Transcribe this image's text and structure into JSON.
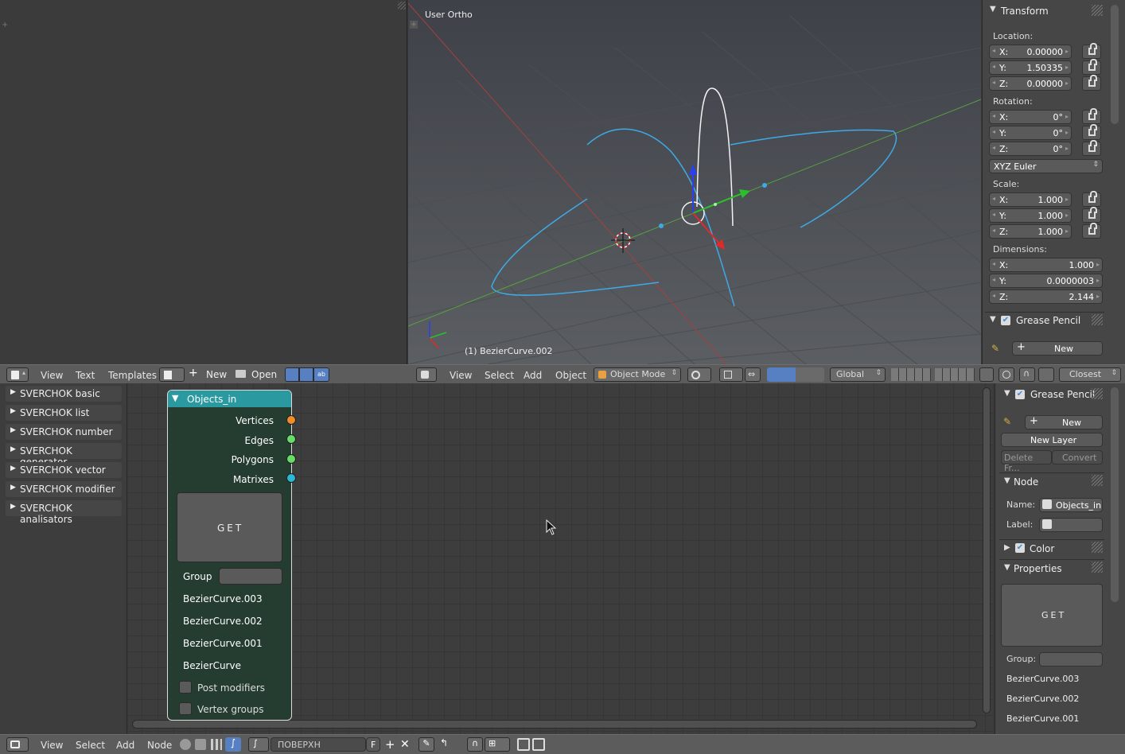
{
  "text_editor": {
    "menu": [
      "View",
      "Text",
      "Templates"
    ],
    "new_label": "New",
    "open_label": "Open"
  },
  "viewport": {
    "title": "User Ortho",
    "object_label": "(1) BezierCurve.002",
    "menu": [
      "View",
      "Select",
      "Add",
      "Object"
    ],
    "mode": "Object Mode",
    "orientation": "Global",
    "snap": "Closest"
  },
  "transform": {
    "title": "Transform",
    "location_label": "Location:",
    "location": [
      {
        "axis": "X:",
        "value": "0.00000"
      },
      {
        "axis": "Y:",
        "value": "1.50335"
      },
      {
        "axis": "Z:",
        "value": "0.00000"
      }
    ],
    "rotation_label": "Rotation:",
    "rotation": [
      {
        "axis": "X:",
        "value": "0°"
      },
      {
        "axis": "Y:",
        "value": "0°"
      },
      {
        "axis": "Z:",
        "value": "0°"
      }
    ],
    "rotation_mode": "XYZ Euler",
    "scale_label": "Scale:",
    "scale": [
      {
        "axis": "X:",
        "value": "1.000"
      },
      {
        "axis": "Y:",
        "value": "1.000"
      },
      {
        "axis": "Z:",
        "value": "1.000"
      }
    ],
    "dimensions_label": "Dimensions:",
    "dimensions": [
      {
        "axis": "X:",
        "value": "1.000"
      },
      {
        "axis": "Y:",
        "value": "0.0000003"
      },
      {
        "axis": "Z:",
        "value": "2.144"
      }
    ],
    "grease_pencil": "Grease Pencil",
    "gp_new": "New"
  },
  "sverchok": {
    "categories": [
      "SVERCHOK basic",
      "SVERCHOK list",
      "SVERCHOK number",
      "SVERCHOK generator",
      "SVERCHOK vector",
      "SVERCHOK modifier",
      "SVERCHOK analisators"
    ]
  },
  "node": {
    "title": "Objects_in",
    "outputs": [
      "Vertices",
      "Edges",
      "Polygons",
      "Matrixes"
    ],
    "get_button": "GET",
    "group_label": "Group",
    "objects": [
      "BezierCurve.003",
      "BezierCurve.002",
      "BezierCurve.001",
      "BezierCurve"
    ],
    "post_modifiers": "Post modifiers",
    "vertex_groups": "Vertex groups",
    "socket_colors": [
      "#f08c2a",
      "#66dd66",
      "#66dd66",
      "#2ab8d6"
    ]
  },
  "node_panel": {
    "grease_pencil": "Grease Pencil",
    "new_label": "New",
    "new_layer": "New Layer",
    "delete_frame": "Delete Fr...",
    "convert": "Convert",
    "node_section": "Node",
    "name_label": "Name:",
    "name_value": "Objects_in",
    "label_label": "Label:",
    "color_section": "Color",
    "properties_section": "Properties",
    "get_button": "GET",
    "group_label": "Group:",
    "objects": [
      "BezierCurve.003",
      "BezierCurve.002",
      "BezierCurve.001"
    ]
  },
  "node_editor": {
    "menu": [
      "View",
      "Select",
      "Add",
      "Node"
    ],
    "tree_name": "ПОВЕРХН",
    "fake_user": "F"
  }
}
